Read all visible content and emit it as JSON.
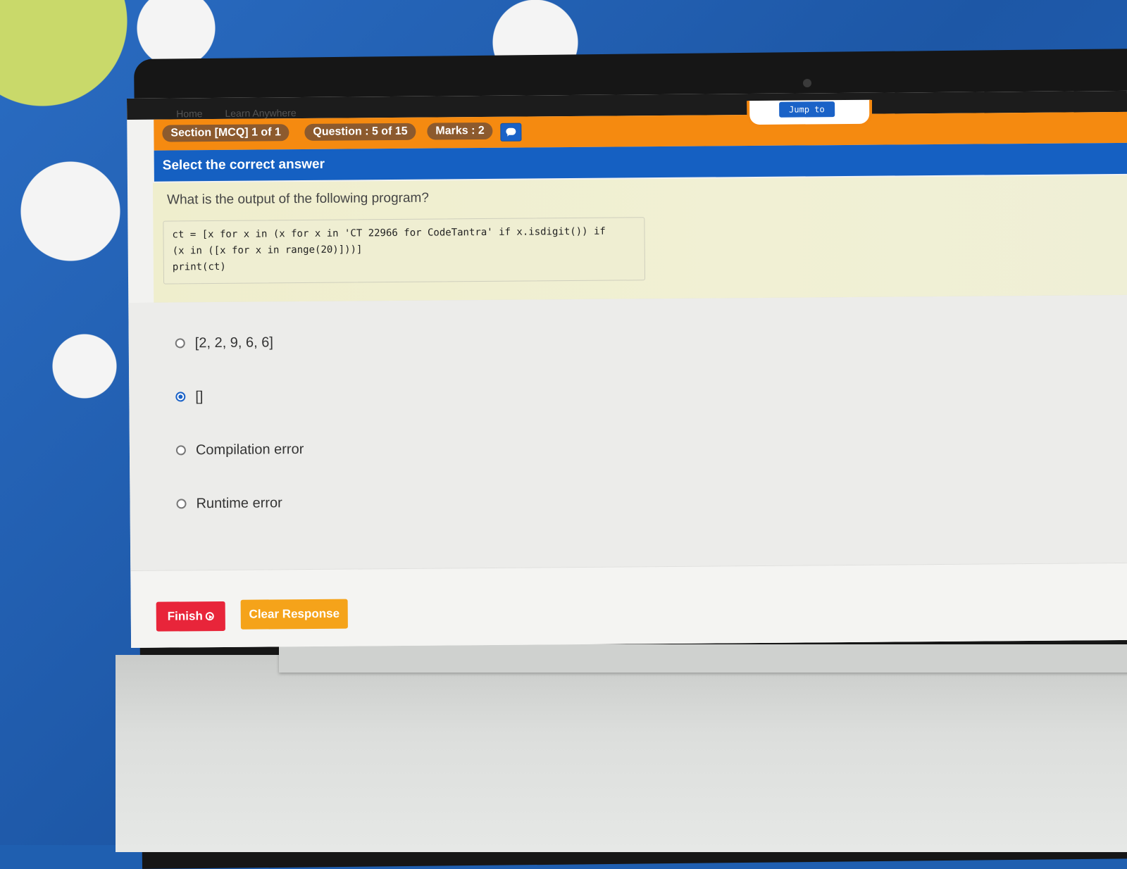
{
  "nav": {
    "crumbs": [
      "Home",
      "Learn Anywhere"
    ],
    "jump_label": "Jump to"
  },
  "header": {
    "section": "Section [MCQ] 1 of 1",
    "question": "Question : 5 of 15",
    "marks": "Marks : 2",
    "instruction": "Select the correct answer"
  },
  "question": {
    "text": "What is the output of the following program?",
    "code": "ct = [x for x in (x for x in 'CT 22966 for CodeTantra' if x.isdigit()) if\n(x in ([x for x in range(20)]))]\nprint(ct)"
  },
  "options": [
    {
      "label": "[2, 2, 9, 6, 6]",
      "selected": false
    },
    {
      "label": "[]",
      "selected": true
    },
    {
      "label": "Compilation error",
      "selected": false
    },
    {
      "label": "Runtime error",
      "selected": false
    }
  ],
  "footer": {
    "finish_label": "Finish",
    "clear_label": "Clear Response"
  },
  "colors": {
    "accent_orange": "#f58a10",
    "header_blue": "#1560c2",
    "finish_red": "#e8253a",
    "clear_amber": "#f5a31a"
  }
}
